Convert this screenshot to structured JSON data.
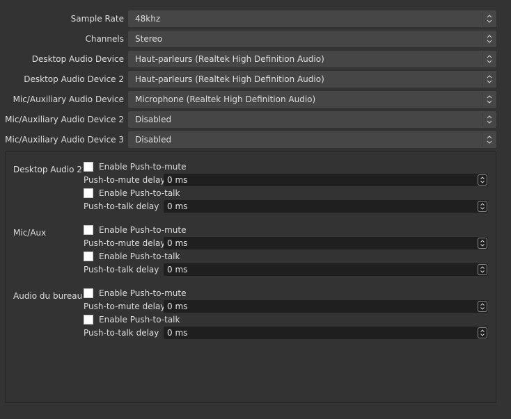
{
  "settings": [
    {
      "label": "Sample Rate",
      "value": "48khz"
    },
    {
      "label": "Channels",
      "value": "Stereo"
    },
    {
      "label": "Desktop Audio Device",
      "value": "Haut-parleurs (Realtek High Definition Audio)"
    },
    {
      "label": "Desktop Audio Device 2",
      "value": "Haut-parleurs (Realtek High Definition Audio)"
    },
    {
      "label": "Mic/Auxiliary Audio Device",
      "value": "Microphone (Realtek High Definition Audio)"
    },
    {
      "label": "Mic/Auxiliary Audio Device 2",
      "value": "Disabled"
    },
    {
      "label": "Mic/Auxiliary Audio Device 3",
      "value": "Disabled"
    }
  ],
  "hotkey_groups": [
    {
      "name": "Desktop Audio 2",
      "push_to_mute": {
        "label": "Enable Push-to-mute",
        "checked": false
      },
      "push_to_mute_delay": {
        "label": "Push-to-mute delay",
        "value": "0 ms"
      },
      "push_to_talk": {
        "label": "Enable Push-to-talk",
        "checked": false
      },
      "push_to_talk_delay": {
        "label": "Push-to-talk delay",
        "value": "0 ms"
      }
    },
    {
      "name": "Mic/Aux",
      "push_to_mute": {
        "label": "Enable Push-to-mute",
        "checked": false
      },
      "push_to_mute_delay": {
        "label": "Push-to-mute delay",
        "value": "0 ms"
      },
      "push_to_talk": {
        "label": "Enable Push-to-talk",
        "checked": false
      },
      "push_to_talk_delay": {
        "label": "Push-to-talk delay",
        "value": "0 ms"
      }
    },
    {
      "name": "Audio du bureau",
      "push_to_mute": {
        "label": "Enable Push-to-mute",
        "checked": false
      },
      "push_to_mute_delay": {
        "label": "Push-to-mute delay",
        "value": "0 ms"
      },
      "push_to_talk": {
        "label": "Enable Push-to-talk",
        "checked": false
      },
      "push_to_talk_delay": {
        "label": "Push-to-talk delay",
        "value": "0 ms"
      }
    }
  ]
}
